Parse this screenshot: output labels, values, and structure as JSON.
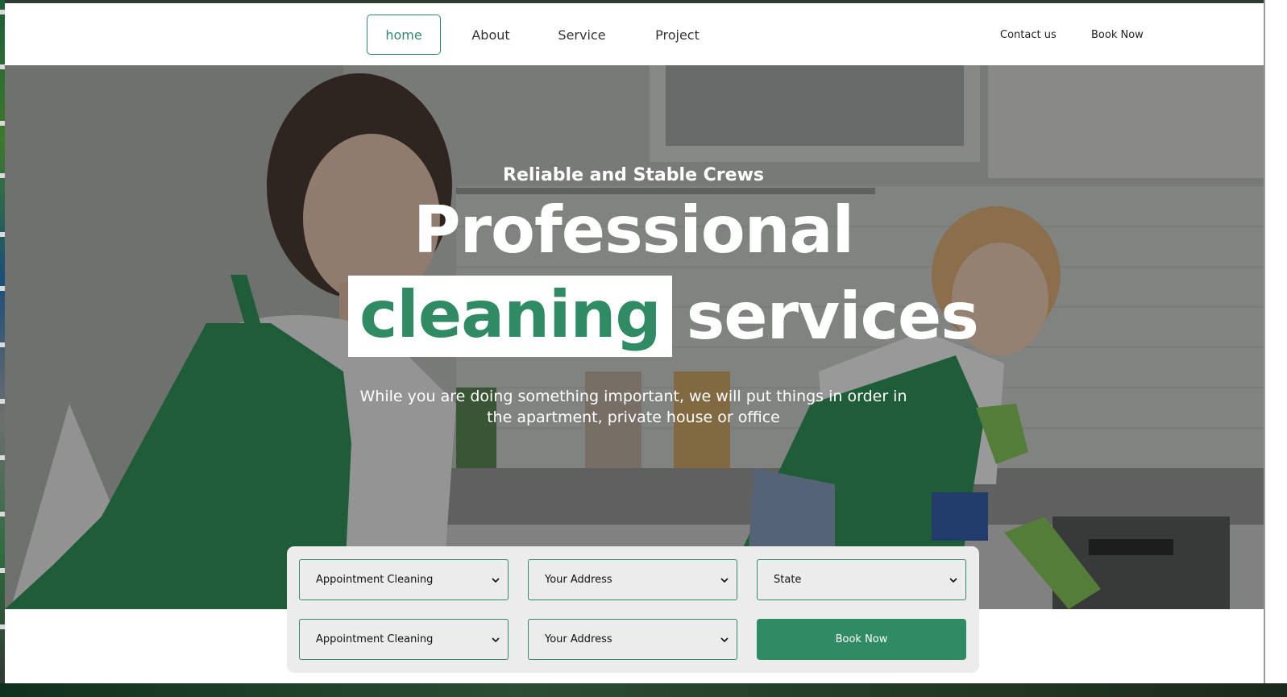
{
  "nav": {
    "items": [
      {
        "label": "home",
        "active": true
      },
      {
        "label": "About",
        "active": false
      },
      {
        "label": "Service",
        "active": false
      },
      {
        "label": "Project",
        "active": false
      }
    ],
    "contact_label": "Contact us",
    "book_label": "Book Now"
  },
  "hero": {
    "subtitle": "Reliable and Stable Crews",
    "title_line1": "Professional",
    "title_highlight": "cleaning",
    "title_rest": "services",
    "description": "While you are doing something important, we will put things in order in the apartment, private house or office"
  },
  "booking": {
    "row1": [
      {
        "value": "Appointment Cleaning"
      },
      {
        "value": "Your Address"
      },
      {
        "value": "State"
      }
    ],
    "row2": [
      {
        "value": "Appointment Cleaning"
      },
      {
        "value": "Your Address"
      }
    ],
    "submit_label": "Book Now"
  },
  "colors": {
    "accent": "#2e8b64",
    "form_bg": "#ececec",
    "nav_bg": "#ffffff"
  },
  "icons": {
    "select_arrow": "chevron-down-icon"
  }
}
